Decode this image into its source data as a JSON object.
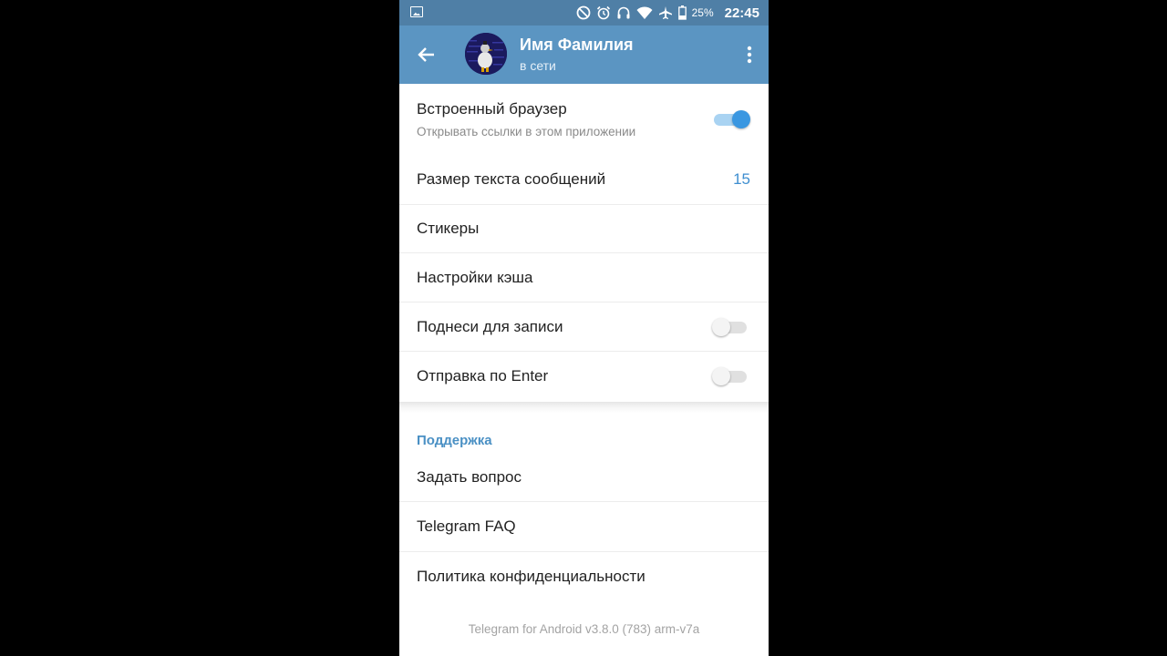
{
  "status_bar": {
    "battery_percent": "25%",
    "time": "22:45"
  },
  "app_bar": {
    "title": "Имя Фамилия",
    "subtitle": "в сети"
  },
  "settings": {
    "in_app_browser": {
      "label": "Встроенный браузер",
      "description": "Открывать ссылки в этом приложении",
      "enabled": true
    },
    "text_size": {
      "label": "Размер текста сообщений",
      "value": "15"
    },
    "stickers": {
      "label": "Стикеры"
    },
    "cache_settings": {
      "label": "Настройки кэша"
    },
    "raise_to_record": {
      "label": "Поднеси для записи",
      "enabled": false
    },
    "send_by_enter": {
      "label": "Отправка по Enter",
      "enabled": false
    }
  },
  "support": {
    "header": "Поддержка",
    "items": [
      {
        "label": "Задать вопрос"
      },
      {
        "label": "Telegram FAQ"
      },
      {
        "label": "Политика конфиденциальности"
      }
    ]
  },
  "footer": {
    "version": "Telegram for Android v3.8.0 (783) arm-v7a"
  },
  "colors": {
    "status_bar": "#4f7fa6",
    "app_bar": "#5b95c2",
    "accent": "#3e8ed0",
    "section_header": "#4a90c4"
  },
  "icons": {
    "status_left": "gallery-icon",
    "status": [
      "do-not-disturb-icon",
      "alarm-icon",
      "headphones-icon",
      "wifi-icon",
      "airplane-mode-icon",
      "battery-icon"
    ],
    "app_bar_left": "back-arrow-icon",
    "app_bar_right": "more-vert-icon"
  }
}
